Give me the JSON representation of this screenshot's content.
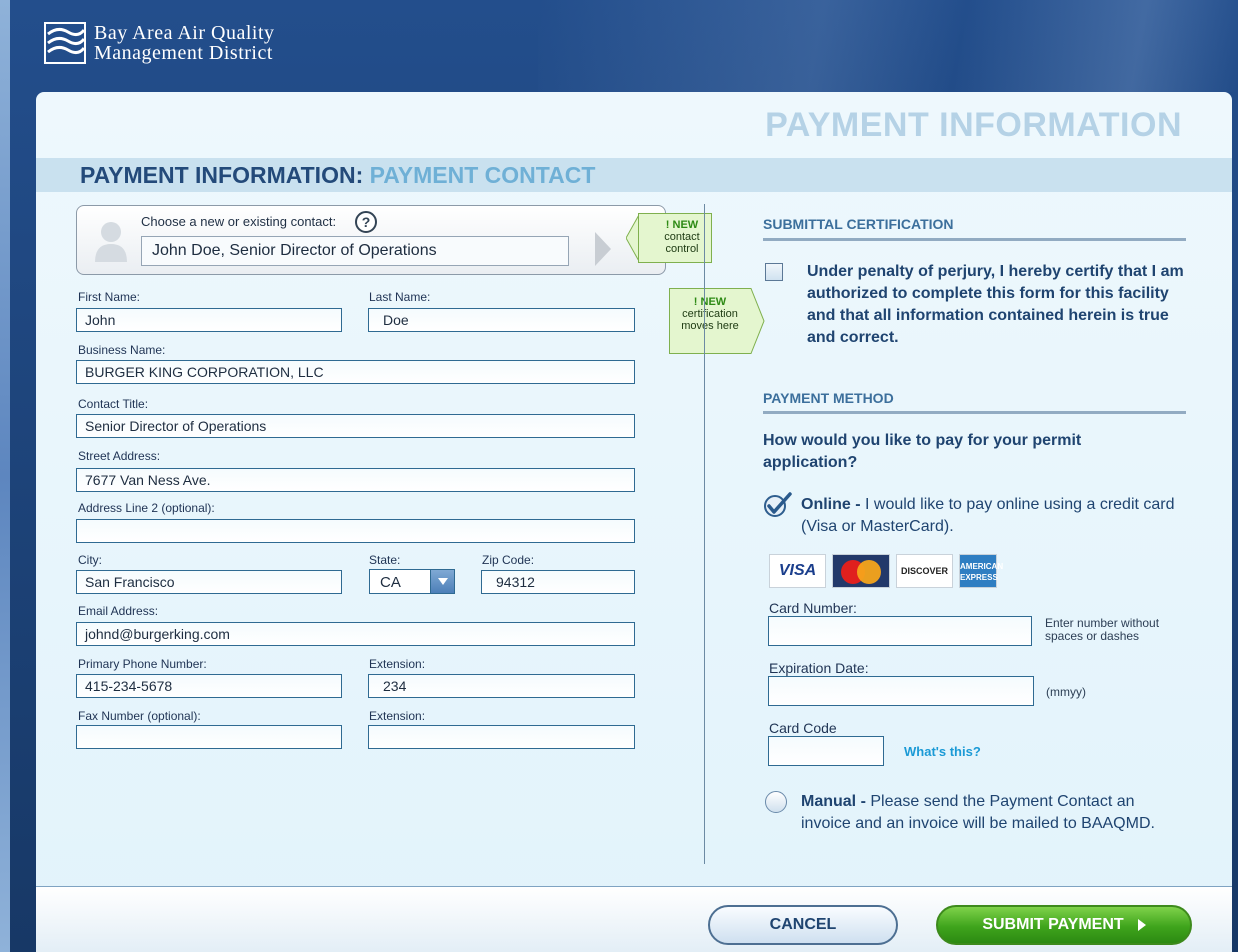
{
  "header": {
    "logo_line1": "Bay Area Air Quality",
    "logo_line2": "Management District"
  },
  "page_title": "PAYMENT INFORMATION",
  "section": {
    "title": "PAYMENT INFORMATION:",
    "subtitle": "PAYMENT CONTACT"
  },
  "contact_chooser": {
    "label": "Choose a new or existing contact:",
    "help": "?",
    "value": "John Doe, Senior Director of Operations"
  },
  "callouts": {
    "contact": {
      "new": "NEW",
      "line1": "contact",
      "line2": "control"
    },
    "certification": {
      "new": "NEW",
      "line1": "certification",
      "line2": "moves here"
    }
  },
  "form": {
    "first_name": {
      "label": "First Name:",
      "value": "John"
    },
    "last_name": {
      "label": "Last Name:",
      "value": "Doe"
    },
    "business_name": {
      "label": "Business Name:",
      "value": "BURGER KING CORPORATION, LLC"
    },
    "contact_title": {
      "label": "Contact Title:",
      "value": "Senior Director of Operations"
    },
    "street_address": {
      "label": "Street Address:",
      "value": "7677 Van Ness Ave."
    },
    "address_line2": {
      "label": "Address Line 2 (optional):",
      "value": ""
    },
    "city": {
      "label": "City:",
      "value": "San Francisco"
    },
    "state": {
      "label": "State:",
      "value": "CA"
    },
    "zip": {
      "label": "Zip Code:",
      "value": "94312"
    },
    "email": {
      "label": "Email Address:",
      "value": "johnd@burgerking.com"
    },
    "phone": {
      "label": "Primary Phone Number:",
      "value": "415-234-5678"
    },
    "phone_ext": {
      "label": "Extension:",
      "value": "234"
    },
    "fax": {
      "label": "Fax Number (optional):",
      "value": ""
    },
    "fax_ext": {
      "label": "Extension:",
      "value": ""
    }
  },
  "certification": {
    "heading": "SUBMITTAL CERTIFICATION",
    "text": "Under penalty of perjury, I hereby certify that I am authorized to complete this form for this facility and that all information contained herein is true and correct.",
    "checked": false
  },
  "payment_method": {
    "heading": "PAYMENT METHOD",
    "question": "How would you like to pay for your permit application?",
    "online": {
      "title": "Online -",
      "text": " I would like to pay online using a credit card (Visa or MasterCard).",
      "selected": true
    },
    "cards": {
      "visa": "VISA",
      "mastercard": "MasterCard",
      "discover": "DISCOVER",
      "amex1": "AMERICAN",
      "amex2": "EXPRESS"
    },
    "card_number": {
      "label": "Card Number:",
      "hint1": "Enter number without",
      "hint2": "spaces or dashes",
      "value": ""
    },
    "expiration": {
      "label": "Expiration Date:",
      "hint": "(mmyy)",
      "value": ""
    },
    "card_code": {
      "label": "Card Code",
      "help_link": "What's this?",
      "value": ""
    },
    "manual": {
      "title": "Manual -",
      "text": " Please send the Payment Contact an invoice and an invoice will be mailed to BAAQMD.",
      "selected": false
    }
  },
  "buttons": {
    "cancel": "CANCEL",
    "submit": "SUBMIT PAYMENT"
  },
  "colors": {
    "brand_navy": "#1b3f74",
    "heading_blue": "#234a7a",
    "accent_light_blue": "#6fb0d6",
    "submit_green": "#3fa41c"
  }
}
